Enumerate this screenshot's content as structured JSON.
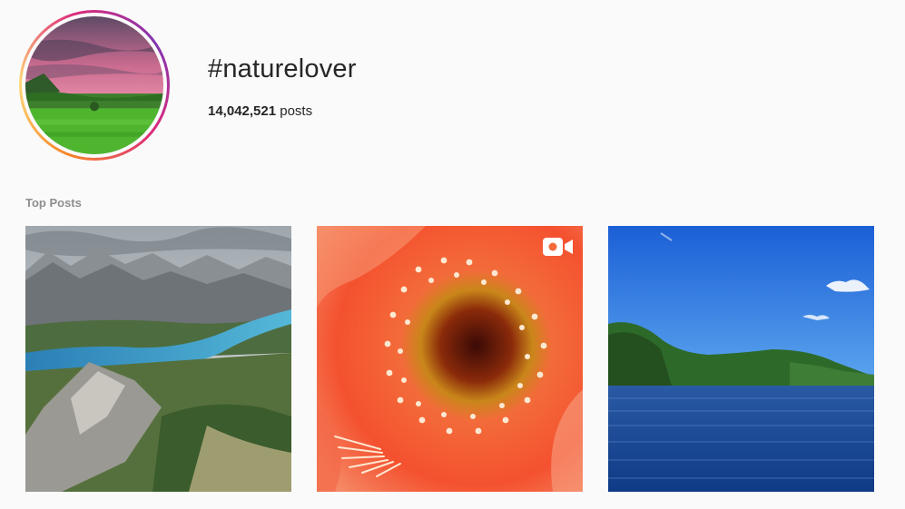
{
  "header": {
    "hashtag": "#naturelover",
    "post_count_number": "14,042,521",
    "post_count_suffix": " posts",
    "avatar_icon": "profile-landscape-image"
  },
  "sections": {
    "top_posts_label": "Top Posts"
  },
  "posts": [
    {
      "subject": "mountain-lake-aerial",
      "is_video": false
    },
    {
      "subject": "red-flower-closeup",
      "is_video": true,
      "badge_icon": "video-icon"
    },
    {
      "subject": "lake-forest-hills",
      "is_video": false
    }
  ],
  "colors": {
    "background": "#fafafa",
    "text_primary": "#262626",
    "text_secondary": "#8e8e8e",
    "story_ring_start": "#f58529",
    "story_ring_end": "#dd2a7b"
  }
}
